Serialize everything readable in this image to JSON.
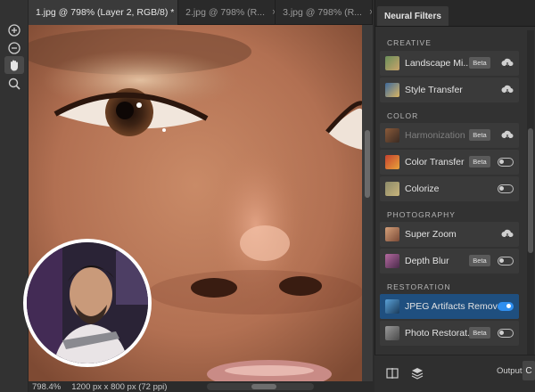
{
  "tabs": [
    {
      "label": "1.jpg @ 798% (Layer 2, RGB/8) *",
      "active": true
    },
    {
      "label": "2.jpg @ 798% (R...",
      "active": false
    },
    {
      "label": "3.jpg @ 798% (R...",
      "active": false
    }
  ],
  "tab_close_glyph": "×",
  "tools": [
    {
      "name": "zoom-in-icon"
    },
    {
      "name": "zoom-out-icon"
    },
    {
      "name": "hand-icon",
      "active": true
    },
    {
      "name": "search-icon"
    }
  ],
  "status": {
    "zoom": "798.4%",
    "dimensions": "1200 px x 800 px (72 ppi)"
  },
  "panel": {
    "tab_label": "Neural Filters",
    "sections": [
      {
        "title": "CREATIVE"
      },
      {
        "title": "COLOR"
      },
      {
        "title": "PHOTOGRAPHY"
      },
      {
        "title": "RESTORATION"
      }
    ],
    "filters": [
      {
        "label": "Landscape Mi...",
        "beta": true,
        "control": "cloud",
        "section": "CREATIVE"
      },
      {
        "label": "Style Transfer",
        "beta": false,
        "control": "cloud",
        "section": "CREATIVE"
      },
      {
        "label": "Harmonization",
        "beta": true,
        "control": "cloud",
        "section": "COLOR",
        "disabled": true
      },
      {
        "label": "Color Transfer",
        "beta": true,
        "control": "toggle",
        "on": false,
        "section": "COLOR"
      },
      {
        "label": "Colorize",
        "beta": false,
        "control": "toggle",
        "on": false,
        "section": "COLOR"
      },
      {
        "label": "Super Zoom",
        "beta": false,
        "control": "cloud",
        "section": "PHOTOGRAPHY"
      },
      {
        "label": "Depth Blur",
        "beta": true,
        "control": "toggle",
        "on": false,
        "section": "PHOTOGRAPHY"
      },
      {
        "label": "JPEG Artifacts Removal",
        "beta": false,
        "control": "toggle",
        "on": true,
        "section": "RESTORATION",
        "selected": true
      },
      {
        "label": "Photo Restorat...",
        "beta": true,
        "control": "toggle",
        "on": false,
        "section": "RESTORATION"
      }
    ],
    "beta_label": "Beta",
    "output_label": "Output",
    "output_value": "C"
  },
  "colors": {
    "accent": "#2f8ff0",
    "selected_row": "#1f4f7f",
    "panel_bg": "#323232"
  }
}
